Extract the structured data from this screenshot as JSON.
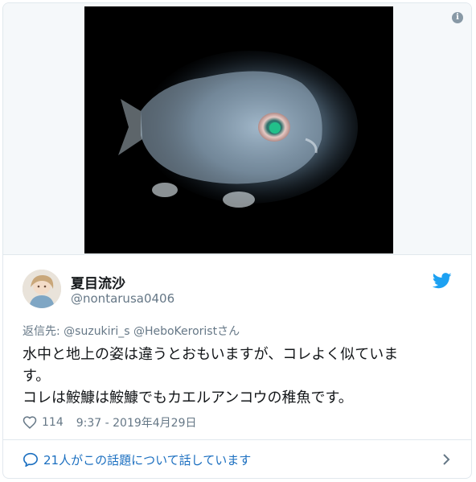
{
  "media": {
    "alt_icon": "info-icon",
    "info_glyph": "i"
  },
  "author": {
    "name": "夏目流沙",
    "handle": "@nontarusa0406",
    "avatar_icon": "avatar"
  },
  "tweet": {
    "reply_prefix": "返信先: ",
    "reply_mentions": "@suzukiri_s @HeboKeroristさん",
    "lines": [
      "水中と地上の姿は違うとおもいますが、コレよく似ていま",
      "す。",
      "コレは鮟鱇は鮟鱇でもカエルアンコウの稚魚です。"
    ],
    "like_count": "114",
    "timestamp": "9:37 - 2019年4月29日"
  },
  "conversation": {
    "label": "21人がこの話題について話しています"
  },
  "colors": {
    "brand": "#1da1f2",
    "link": "#1b6fc0",
    "muted": "#657786",
    "border": "#e1e8ed"
  },
  "icons": [
    "info-icon",
    "twitter-bird-icon",
    "heart-icon",
    "speech-bubble-icon",
    "chevron-right-icon"
  ]
}
